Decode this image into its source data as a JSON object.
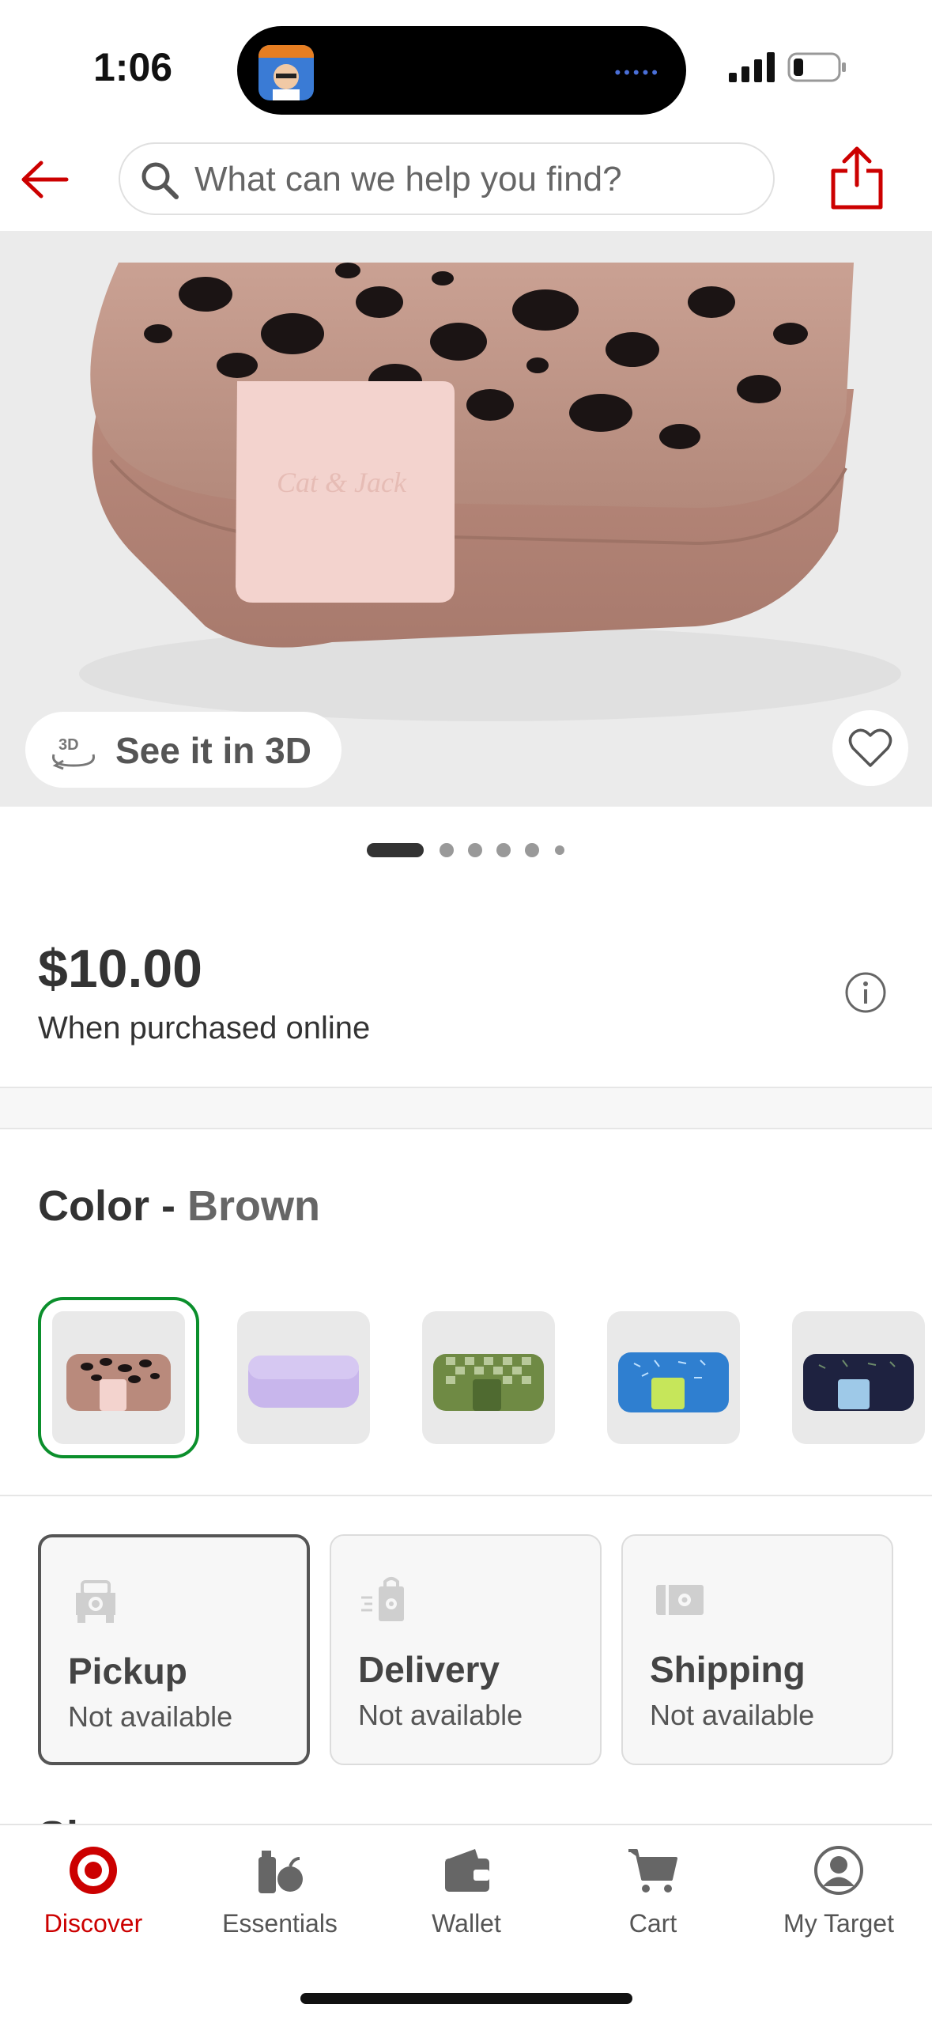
{
  "status": {
    "time": "1:06"
  },
  "header": {
    "search_placeholder": "What can we help you find?"
  },
  "product": {
    "see_3d_label": "See it in 3D",
    "carousel_count": 6,
    "carousel_active_index": 0,
    "price": "$10.00",
    "price_note": "When purchased online"
  },
  "color": {
    "label": "Color",
    "separator": " - ",
    "selected": "Brown",
    "swatches": [
      {
        "name": "brown-leopard",
        "color": "#b98a7c"
      },
      {
        "name": "lavender",
        "color": "#c8b6ec"
      },
      {
        "name": "green-checker",
        "color": "#6f8a44"
      },
      {
        "name": "blue-pattern",
        "color": "#2f7fd0"
      },
      {
        "name": "navy-pattern",
        "color": "#1e2240"
      }
    ]
  },
  "fulfillment": [
    {
      "title": "Pickup",
      "status": "Not available",
      "icon": "car-icon"
    },
    {
      "title": "Delivery",
      "status": "Not available",
      "icon": "bag-icon"
    },
    {
      "title": "Shipping",
      "status": "Not available",
      "icon": "truck-icon"
    }
  ],
  "store_partial": "Shawnee",
  "tabs": [
    {
      "label": "Discover",
      "icon": "target-bullseye-icon"
    },
    {
      "label": "Essentials",
      "icon": "essentials-icon"
    },
    {
      "label": "Wallet",
      "icon": "wallet-icon"
    },
    {
      "label": "Cart",
      "icon": "cart-icon"
    },
    {
      "label": "My Target",
      "icon": "profile-icon"
    }
  ],
  "colors": {
    "brand_red": "#cc0000",
    "selected_green": "#0b8f2c"
  }
}
